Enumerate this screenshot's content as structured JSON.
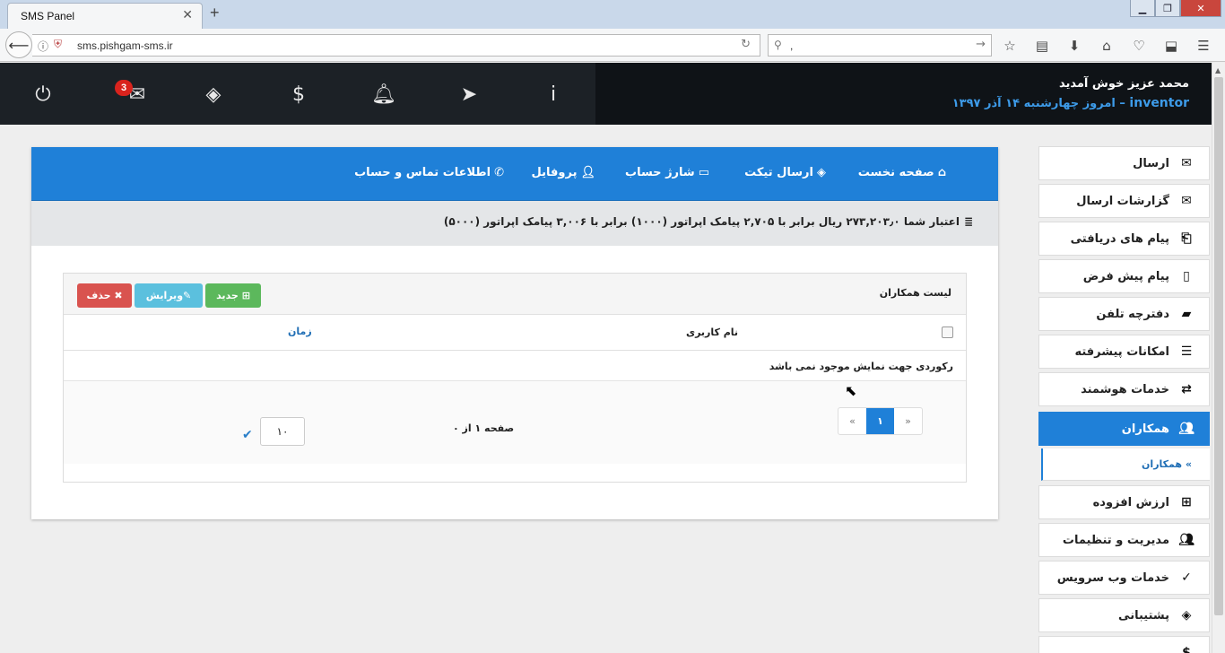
{
  "browser": {
    "tab_title": "SMS Panel",
    "tab_close": "✕",
    "new_tab": "+",
    "url": "sms.pishgam-sms.ir",
    "search_text": ","
  },
  "header": {
    "welcome": "محمد عزیز خوش آمدید",
    "username": "inventor",
    "separator": " – ",
    "today": "امروز چهارشنبه ۱۴ آذر ۱۳۹۷",
    "unread_count": "3"
  },
  "panel_nav": {
    "home": "صفحه نخست",
    "ticket": "ارسال تیکت",
    "charge": "شارژ حساب",
    "profile": "پروفایل",
    "contact": "اطلاعات تماس و حساب"
  },
  "credit": {
    "text": "اعتبار شما ۲۷۳,۲۰۳٫۰ ریال برابر با ۲,۷۰۵ پیامک اپراتور (۱۰۰۰) برابر با ۳,۰۰۶ پیامک اپراتور (۵۰۰۰)"
  },
  "card": {
    "title": "لیست همکاران",
    "btn_new": "جدید",
    "btn_edit": "ویرایش",
    "btn_delete": "حذف",
    "col_username": "نام کاربری",
    "col_time": "زمان",
    "empty_text": "رکوردی جهت نمایش موجود نمی باشد",
    "pager_prev": "«",
    "pager_current": "۱",
    "pager_next": "»",
    "page_of": "صفحه ۱ از ۰",
    "page_size": "۱۰"
  },
  "sidebar": {
    "items": [
      {
        "label": "ارسال"
      },
      {
        "label": "گزارشات ارسال"
      },
      {
        "label": "پیام های دریافتی"
      },
      {
        "label": "پیام پیش فرض"
      },
      {
        "label": "دفترچه تلفن"
      },
      {
        "label": "امکانات پیشرفته"
      },
      {
        "label": "خدمات هوشمند"
      },
      {
        "label": "همکاران"
      },
      {
        "label": "ارزش افزوده"
      },
      {
        "label": "مدیریت و تنظیمات"
      },
      {
        "label": "خدمات وب سرویس"
      },
      {
        "label": "پشتیبانی"
      }
    ],
    "sub_item": "همکاران",
    "active_color": "#1f80d8"
  }
}
